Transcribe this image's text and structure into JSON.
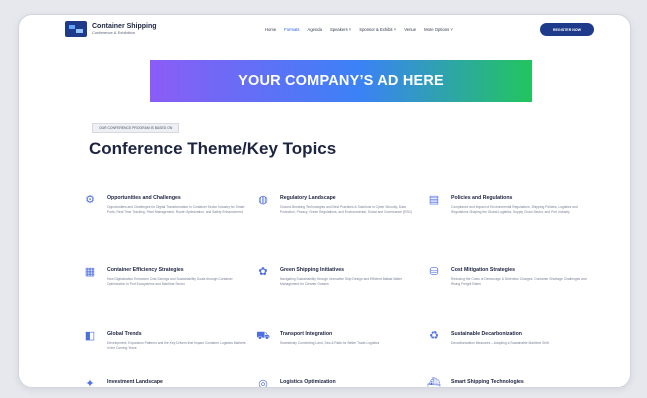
{
  "header": {
    "logo_title": "Container Shipping",
    "logo_sub": "Conference & Exhibition",
    "menu": [
      "Home",
      "Formats",
      "Agenda",
      "Speakers ˅",
      "Sponsor & Exhibit ˅",
      "Venue",
      "More Options ˅"
    ],
    "register_label": "REGISTER NOW"
  },
  "ad": {
    "text": "YOUR COMPANY’S AD HERE"
  },
  "section": {
    "eyebrow": "OUR CONFERENCE PROGRAM IS BASED ON",
    "title": "Conference Theme/Key Topics"
  },
  "topics": [
    {
      "title": "Opportunities and Challenges",
      "desc": "Opportunities and Challenges for Digital Transformation in Container Sector Industry for Smart Ports, Real Time Tracking, Fleet Management, Route Optimization, and Safety Enhancement",
      "icon": "network-icon"
    },
    {
      "title": "Regulatory Landscape",
      "desc": "Ground-Breaking Technologies and Best Practices & Solutions in Cyber Security, Data Protection, Privacy, Green Regulations, and Environmental, Social and Governance (ESG)",
      "icon": "globe-icon"
    },
    {
      "title": "Policies and Regulations",
      "desc": "Compliance and Impact of Environmental Regulations, Shipping Policies, Logistics and Regulations Shaping the Global Logistics, Supply Chain Sector, and Port Industry",
      "icon": "document-icon"
    },
    {
      "title": "Container Efficiency Strategies",
      "desc": "How Digitalization Enhances Cost Savings and Sustainability Goals through Container Optimization in Port Ecosystems and Maritime Sector",
      "icon": "container-icon"
    },
    {
      "title": "Green Shipping Initiatives",
      "desc": "Navigating Sustainability through Innovative Ship Design and Efficient Ballast Water Management for Cleaner Oceans",
      "icon": "leaf-icon"
    },
    {
      "title": "Cost Mitigation Strategies",
      "desc": "Reducing the Costs of Demurrage & Detention Charges. Container Shortage Challenges and Rising Freight Rates",
      "icon": "coins-icon"
    },
    {
      "title": "Global Trends",
      "desc": "Development, Expansion Patterns and the Key Drivers that Impact Container Logistics Markets in the Coming Years",
      "icon": "chart-icon"
    },
    {
      "title": "Transport Integration",
      "desc": "Seamlessly Connecting Land, Sea & Rails for Better Trade Logistics",
      "icon": "truck-icon"
    },
    {
      "title": "Sustainable Decarbonization",
      "desc": "Decarbonization Measures – Adopting a Sustainable Maritime Shift",
      "icon": "eco-icon"
    },
    {
      "title": "Investment Landscape",
      "desc": "",
      "icon": "investment-icon"
    },
    {
      "title": "Logistics Optimization",
      "desc": "",
      "icon": "logistics-icon"
    },
    {
      "title": "Smart Shipping Technologies",
      "desc": "",
      "icon": "ship-icon"
    }
  ]
}
